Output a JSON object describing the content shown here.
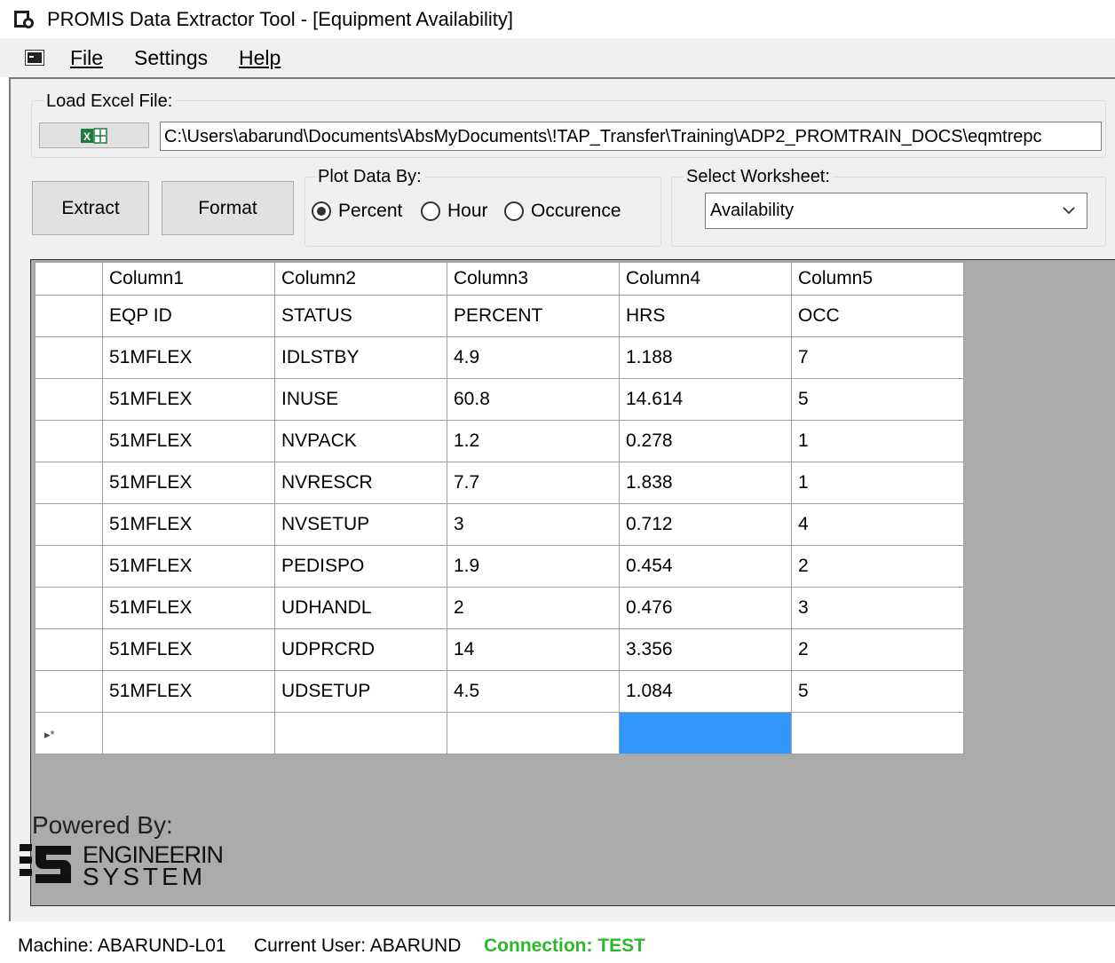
{
  "window": {
    "title": "PROMIS Data Extractor Tool - [Equipment Availability]"
  },
  "menu": {
    "file": "File",
    "settings": "Settings",
    "help": "Help"
  },
  "load_excel": {
    "legend": "Load Excel File:",
    "button_icon": "excel-icon",
    "path": "C:\\Users\\abarund\\Documents\\AbsMyDocuments\\!TAP_Transfer\\Training\\ADP2_PROMTRAIN_DOCS\\eqmtrepc"
  },
  "actions": {
    "extract": "Extract",
    "format": "Format"
  },
  "plot_by": {
    "legend": "Plot Data By:",
    "options": [
      "Percent",
      "Hour",
      "Occurence"
    ],
    "selected": "Percent"
  },
  "worksheet": {
    "legend": "Select Worksheet:",
    "selected": "Availability"
  },
  "grid": {
    "headers": [
      "Column1",
      "Column2",
      "Column3",
      "Column4",
      "Column5"
    ],
    "rows": [
      [
        "EQP ID",
        "STATUS",
        "PERCENT",
        "HRS",
        "OCC"
      ],
      [
        "51MFLEX",
        "IDLSTBY",
        "4.9",
        "1.188",
        "7"
      ],
      [
        "51MFLEX",
        "INUSE",
        "60.8",
        "14.614",
        "5"
      ],
      [
        "51MFLEX",
        "NVPACK",
        "1.2",
        "0.278",
        "1"
      ],
      [
        "51MFLEX",
        "NVRESCR",
        "7.7",
        "1.838",
        "1"
      ],
      [
        "51MFLEX",
        "NVSETUP",
        "3",
        "0.712",
        "4"
      ],
      [
        "51MFLEX",
        "PEDISPO",
        "1.9",
        "0.454",
        "2"
      ],
      [
        "51MFLEX",
        "UDHANDL",
        "2",
        "0.476",
        "3"
      ],
      [
        "51MFLEX",
        "UDPRCRD",
        "14",
        "3.356",
        "2"
      ],
      [
        "51MFLEX",
        "UDSETUP",
        "4.5",
        "1.084",
        "5"
      ]
    ],
    "new_row_marker": "▸*"
  },
  "branding": {
    "powered_by": "Powered By:",
    "logo_line1": "ENGINEERIN",
    "logo_line2": "SYSTEM"
  },
  "status": {
    "machine": "Machine: ABARUND-L01",
    "user": "Current User: ABARUND",
    "connection": "Connection: TEST",
    "connection_color": "#2bb82b"
  },
  "colors": {
    "selection": "#3296ff",
    "grid_background": "#ababab",
    "panel_background": "#f0f0f0"
  }
}
